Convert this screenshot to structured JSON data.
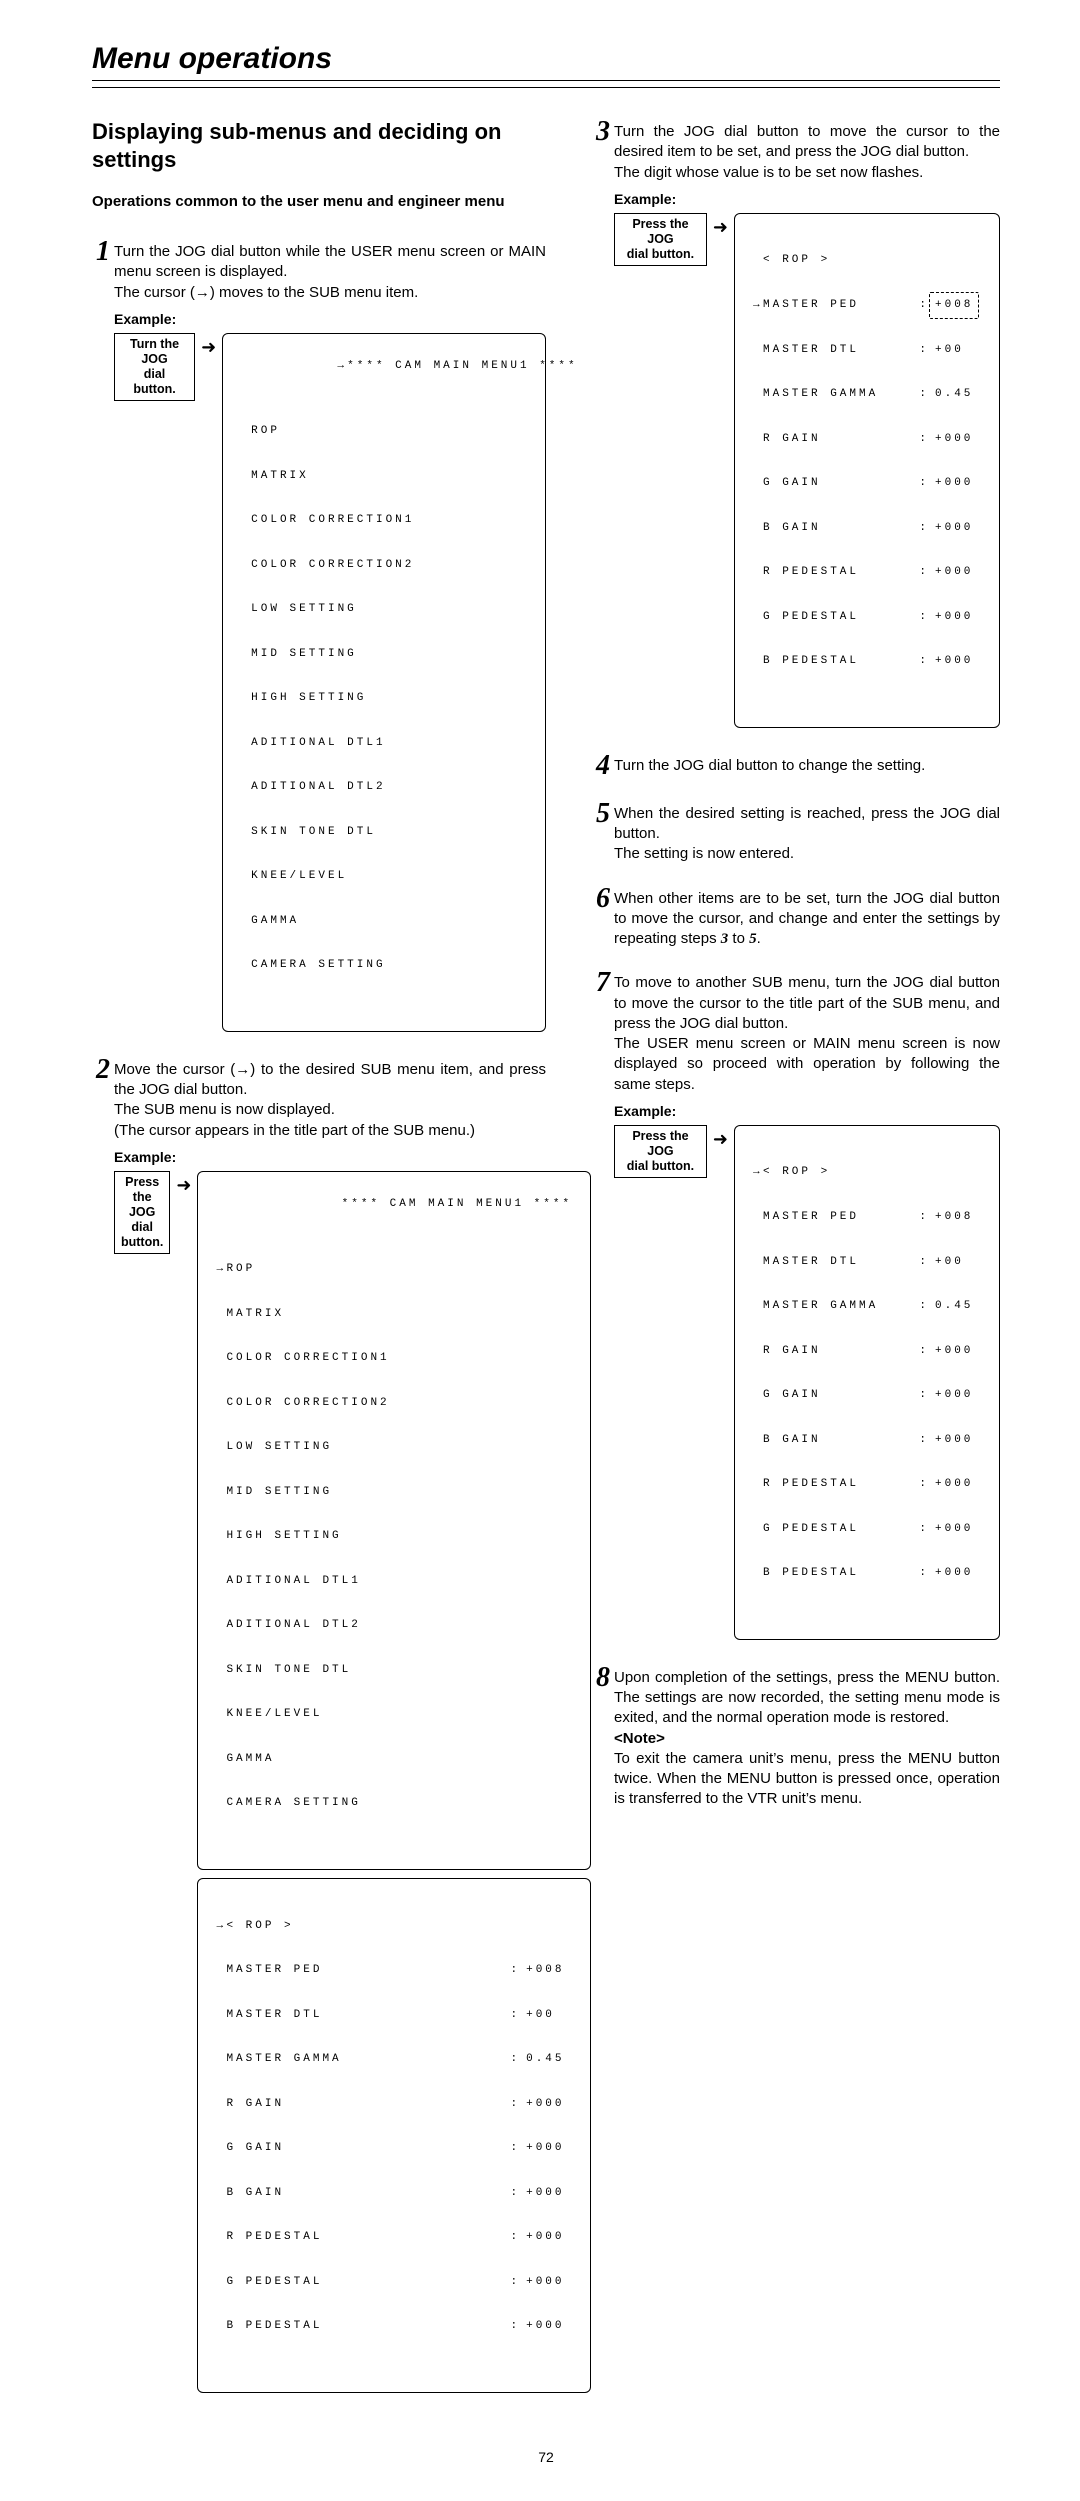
{
  "page_title": "Menu operations",
  "page_number": "72",
  "section_title": "Displaying sub-menus and deciding on settings",
  "lead": "Operations common to the user menu and engineer menu",
  "example_label": "Example:",
  "instr_turn": {
    "l1": "Turn the JOG",
    "l2": "dial button."
  },
  "instr_press": {
    "l1": "Press the JOG",
    "l2": "dial button."
  },
  "steps": {
    "s1": "Turn the JOG dial button while the USER menu screen or MAIN menu screen is displayed.\nThe cursor (→) moves to the SUB menu item.",
    "s2": "Move the cursor (→) to the desired SUB menu item, and press the JOG dial button.\nThe SUB menu is now displayed.\n(The cursor appears in the title part of the SUB menu.)",
    "s3": "Turn the JOG dial button to move the cursor to the desired item to be set, and press the JOG dial button.\nThe digit whose value is to be set now flashes.",
    "s4": "Turn the JOG dial button to change the setting.",
    "s5": "When the desired setting is reached, press the JOG dial button.\nThe setting is now entered.",
    "s6a": "When other items are to be set, turn the JOG dial button to move the cursor, and change and enter the settings by repeating steps ",
    "s6b": "3",
    "s6c": " to ",
    "s6d": "5",
    "s6e": ".",
    "s7": "To move to another SUB menu, turn the JOG dial button to move the cursor to the title part of the SUB menu, and press the JOG dial button.\nThe USER menu screen or MAIN menu screen is now displayed so proceed with operation by following the same steps.",
    "s8": "Upon completion of the settings, press the MENU button. The settings are now recorded, the setting menu mode is exited, and the normal operation mode is restored."
  },
  "note_label": "<Note>",
  "note_text": "To exit the camera unit’s menu, press the MENU button twice. When the MENU button is pressed once, operation is transferred to the VTR unit’s menu.",
  "main_menu": {
    "title": "**** CAM MAIN MENU1 ****",
    "items": [
      "ROP",
      "MATRIX",
      "COLOR CORRECTION1",
      "COLOR CORRECTION2",
      "LOW SETTING",
      "MID SETTING",
      "HIGH SETTING",
      "ADITIONAL DTL1",
      "ADITIONAL DTL2",
      "SKIN TONE DTL",
      "KNEE/LEVEL",
      "GAMMA",
      "CAMERA SETTING"
    ]
  },
  "rop": {
    "title": "< ROP >",
    "rows": [
      {
        "label": "MASTER PED",
        "val": "+008"
      },
      {
        "label": "MASTER DTL",
        "val": "+00"
      },
      {
        "label": "MASTER GAMMA",
        "val": "0.45"
      },
      {
        "label": "R GAIN",
        "val": "+000"
      },
      {
        "label": "G GAIN",
        "val": "+000"
      },
      {
        "label": "B GAIN",
        "val": "+000"
      },
      {
        "label": "R PEDESTAL",
        "val": "+000"
      },
      {
        "label": "G PEDESTAL",
        "val": "+000"
      },
      {
        "label": "B PEDESTAL",
        "val": "+000"
      }
    ]
  }
}
